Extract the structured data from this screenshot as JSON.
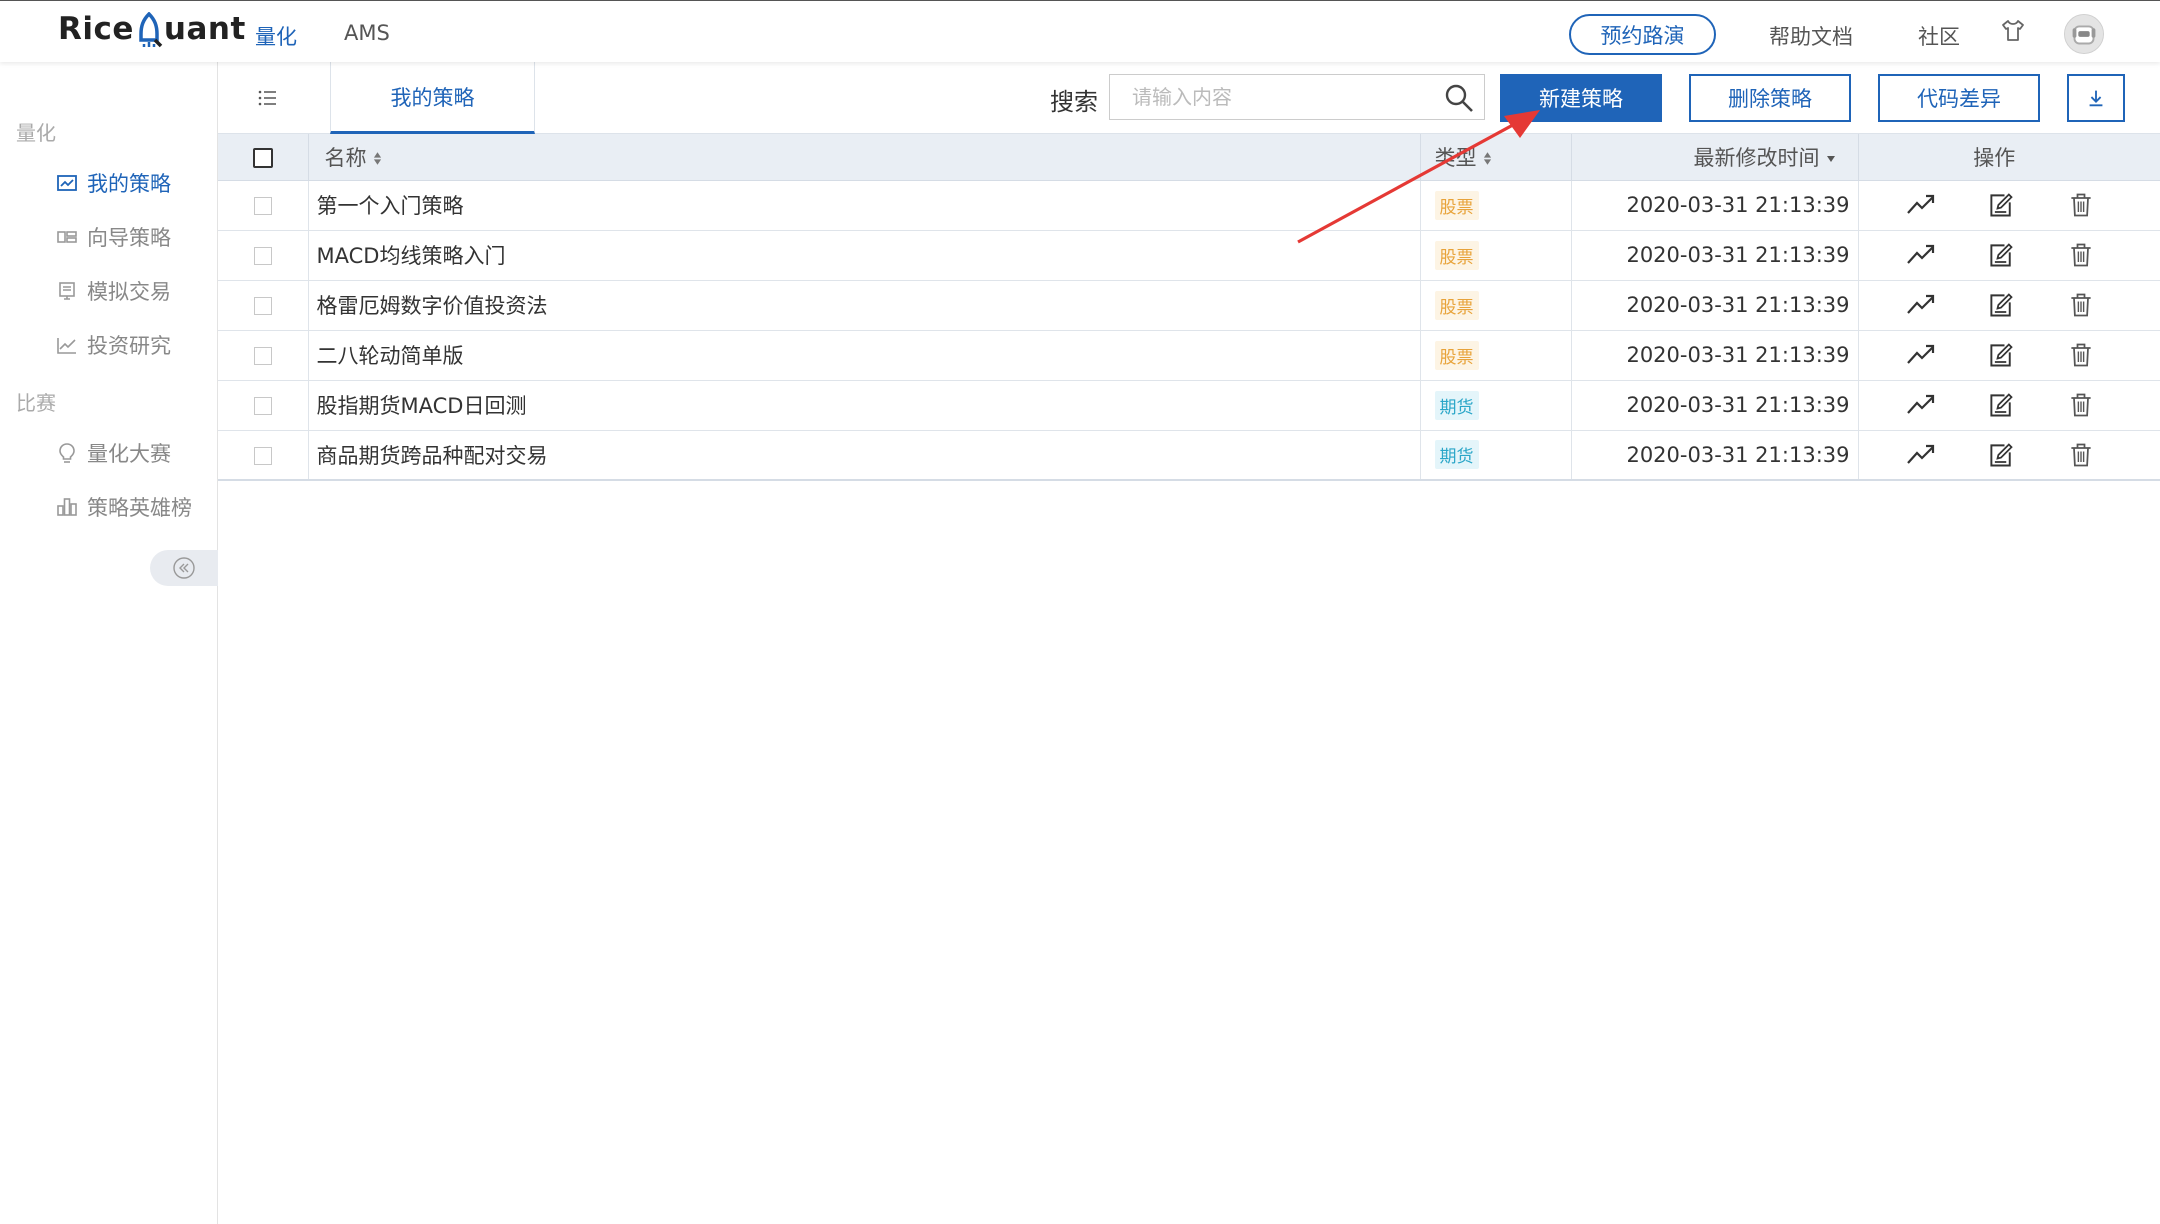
{
  "topbar": {
    "logo_left": "Rice",
    "logo_right": "uant",
    "nav": [
      "量化",
      "AMS"
    ],
    "demo_button": "预约路演",
    "help_link": "帮助文档",
    "community_link": "社区"
  },
  "sidebar": {
    "group1": "量化",
    "items1": [
      "我的策略",
      "向导策略",
      "模拟交易",
      "投资研究"
    ],
    "group2": "比赛",
    "items2": [
      "量化大赛",
      "策略英雄榜"
    ]
  },
  "toolbar": {
    "tab": "我的策略",
    "search_label": "搜索",
    "search_placeholder": "请输入内容",
    "new_button": "新建策略",
    "delete_button": "删除策略",
    "diff_button": "代码差异"
  },
  "table": {
    "headers": {
      "name": "名称",
      "type": "类型",
      "time": "最新修改时间",
      "ops": "操作"
    },
    "rows": [
      {
        "name": "第一个入门策略",
        "type": "股票",
        "time": "2020-03-31 21:13:39"
      },
      {
        "name": "MACD均线策略入门",
        "type": "股票",
        "time": "2020-03-31 21:13:39"
      },
      {
        "name": "格雷厄姆数字价值投资法",
        "type": "股票",
        "time": "2020-03-31 21:13:39"
      },
      {
        "name": "二八轮动简单版",
        "type": "股票",
        "time": "2020-03-31 21:13:39"
      },
      {
        "name": "股指期货MACD日回测",
        "type": "期货",
        "time": "2020-03-31 21:13:39"
      },
      {
        "name": "商品期货跨品种配对交易",
        "type": "期货",
        "time": "2020-03-31 21:13:39"
      }
    ]
  },
  "colors": {
    "accent": "#1f64b8",
    "stock": "#e8a33a",
    "future": "#2aa6c8",
    "annotation_arrow": "#e53935"
  }
}
